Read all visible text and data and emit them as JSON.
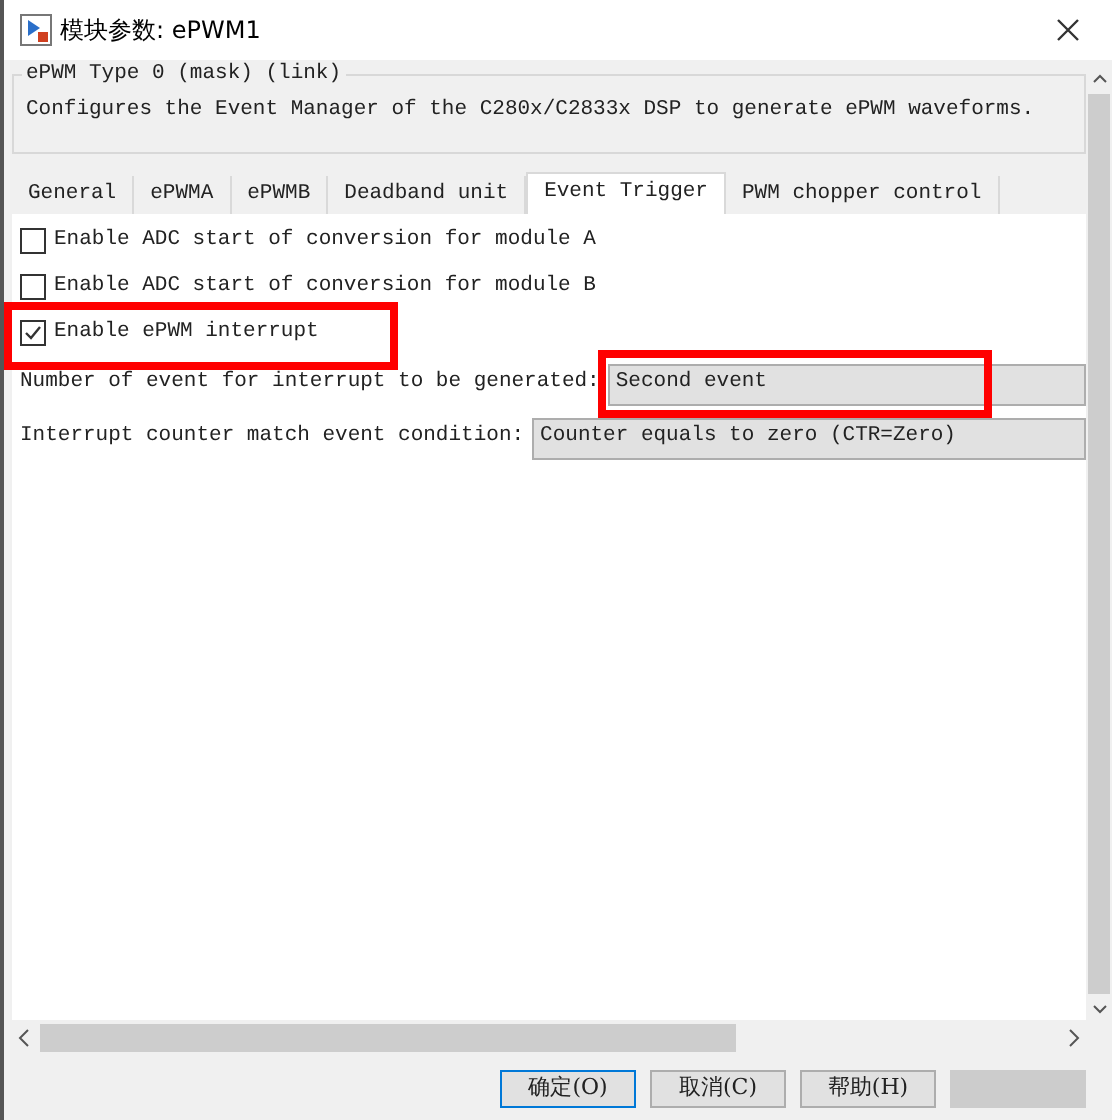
{
  "window": {
    "title": "模块参数: ePWM1"
  },
  "group": {
    "title": "ePWM Type 0 (mask) (link)",
    "description": "Configures the Event Manager of the C280x/C2833x DSP to generate ePWM waveforms."
  },
  "tabs": [
    {
      "label": "General",
      "selected": false
    },
    {
      "label": "ePWMA",
      "selected": false
    },
    {
      "label": "ePWMB",
      "selected": false
    },
    {
      "label": "Deadband unit",
      "selected": false
    },
    {
      "label": "Event Trigger",
      "selected": true
    },
    {
      "label": "PWM chopper control",
      "selected": false
    }
  ],
  "params": [
    {
      "kind": "checkbox",
      "label": "Enable ADC start of conversion for module A",
      "checked": false,
      "highlighted": false
    },
    {
      "kind": "checkbox",
      "label": "Enable ADC start of conversion for module B",
      "checked": false,
      "highlighted": false
    },
    {
      "kind": "checkbox",
      "label": "Enable ePWM interrupt",
      "checked": true,
      "highlighted": true
    },
    {
      "kind": "dropdown",
      "label": "Number of event for interrupt to be generated:",
      "value": "Second event",
      "highlighted": true
    },
    {
      "kind": "dropdown",
      "label": "Interrupt counter match event condition:",
      "value": "Counter equals to zero (CTR=Zero)",
      "highlighted": false
    }
  ],
  "buttons": [
    {
      "label": "确定(O)",
      "selected": true,
      "disabled": false
    },
    {
      "label": "取消(C)",
      "selected": false,
      "disabled": false
    },
    {
      "label": "帮助(H)",
      "selected": false,
      "disabled": false
    },
    {
      "selected": false,
      "disabled": true
    }
  ]
}
